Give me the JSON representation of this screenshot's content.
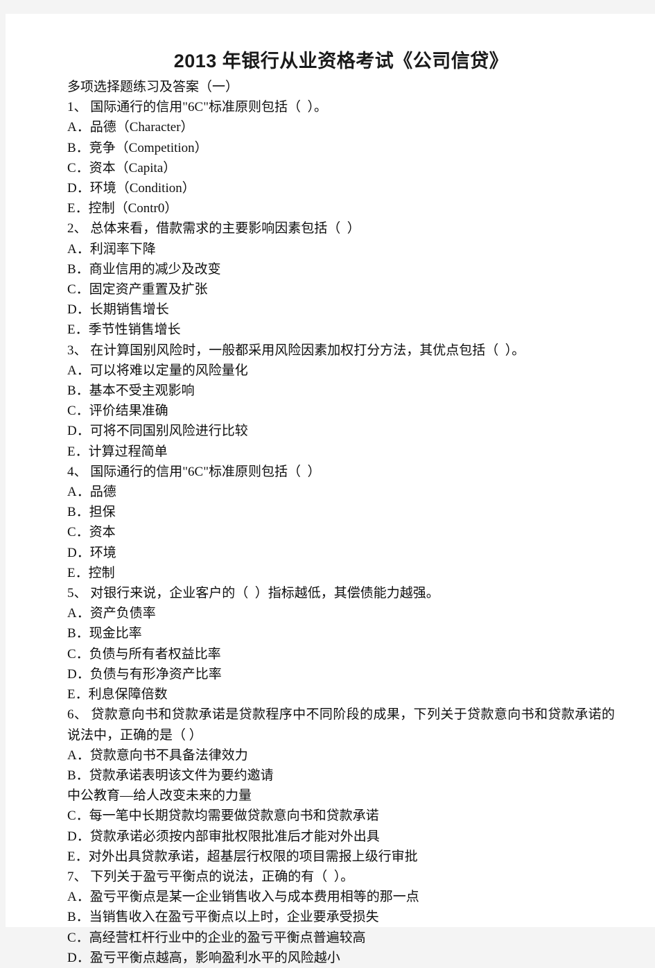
{
  "document": {
    "title": "2013 年银行从业资格考试《公司信贷》",
    "subtitle": "多项选择题练习及答案（一）",
    "watermark_line": "中公教育—给人改变未来的力量",
    "page_background": "#ffffff",
    "canvas_background": "#f4f4f4",
    "text_color": "#101010"
  },
  "questions": [
    {
      "number": "1、",
      "stem": " 国际通行的信用\"6C\"标准原则包括（  ）。",
      "options": [
        "A．品德（Character）",
        "B．竞争（Competition）",
        "C．资本（Capita）",
        "D．环境（Condition）",
        "E．控制（Contr0）"
      ]
    },
    {
      "number": "2、",
      "stem": " 总体来看，借款需求的主要影响因素包括（  ）",
      "options": [
        "A．利润率下降",
        "B．商业信用的减少及改变",
        "C．固定资产重置及扩张",
        "D．长期销售增长",
        "E．季节性销售增长"
      ]
    },
    {
      "number": "3、",
      "stem": " 在计算国别风险时，一般都采用风险因素加权打分方法，其优点包括（  ）。",
      "options": [
        "A．可以将难以定量的风险量化",
        "B．基本不受主观影响",
        "C．评价结果准确",
        "D．可将不同国别风险进行比较",
        "E．计算过程简单"
      ]
    },
    {
      "number": "4、",
      "stem": " 国际通行的信用\"6C\"标准原则包括（  ）",
      "options": [
        "A．品德",
        "B．担保",
        "C．资本",
        "D．环境",
        "E．控制"
      ]
    },
    {
      "number": "5、",
      "stem": " 对银行来说，企业客户的（  ）指标越低，其偿债能力越强。",
      "options": [
        "A．资产负债率",
        "B．现金比率",
        "C．负债与所有者权益比率",
        "D．负债与有形净资产比率",
        "E．利息保障倍数"
      ]
    },
    {
      "number": "6、",
      "stem": " 贷款意向书和贷款承诺是贷款程序中不同阶段的成果，下列关于贷款意向书和贷款承诺的说法中，正确的是（  ）",
      "options": [
        "A．贷款意向书不具备法律效力",
        "B．贷款承诺表明该文件为要约邀请"
      ],
      "options_after_watermark": [
        "C．每一笔中长期贷款均需要做贷款意向书和贷款承诺",
        "D．贷款承诺必须按内部审批权限批准后才能对外出具",
        "E．对外出具贷款承诺，超基层行权限的项目需报上级行审批"
      ]
    },
    {
      "number": "7、",
      "stem": " 下列关于盈亏平衡点的说法，正确的有（  ）。",
      "options": [
        "A．盈亏平衡点是某一企业销售收入与成本费用相等的那一点",
        "B．当销售收入在盈亏平衡点以上时，企业要承受损失",
        "C．高经营杠杆行业中的企业的盈亏平衡点普遍较高",
        "D．盈亏平衡点越高，影响盈利水平的风险越小"
      ]
    }
  ]
}
